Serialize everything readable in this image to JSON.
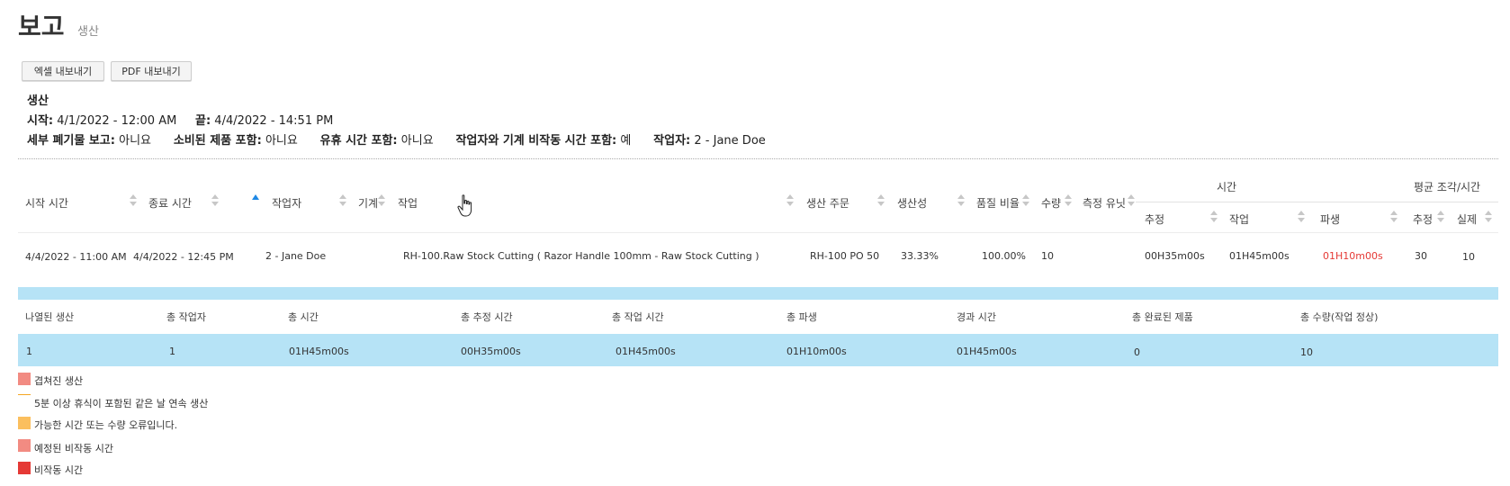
{
  "page": {
    "title": "보고",
    "subtitle": "생산"
  },
  "buttons": {
    "excel": "엑셀 내보내기",
    "pdf": "PDF 내보내기"
  },
  "info": {
    "heading": "생산",
    "start_label": "시작:",
    "start_value": "4/1/2022 - 12:00 AM",
    "end_label": "끝:",
    "end_value": "4/4/2022 - 14:51 PM",
    "detail_scrap_label": "세부 폐기물 보고:",
    "detail_scrap_value": "아니요",
    "consumed_label": "소비된 제품 포함:",
    "consumed_value": "아니요",
    "idle_label": "유휴 시간 포함:",
    "idle_value": "아니요",
    "downtime_label": "작업자와 기계 비작동 시간 포함:",
    "downtime_value": "예",
    "operator_label": "작업자:",
    "operator_value": "2 - Jane Doe"
  },
  "table": {
    "group_time": "시간",
    "group_avg": "평균 조각/시간",
    "headers": {
      "start_time": "시작 시간",
      "end_time": "종료 시간",
      "operator": "작업자",
      "machine": "기계",
      "job": "작업",
      "order": "생산 주문",
      "productivity": "생산성",
      "quality": "품질 비율",
      "quantity": "수량",
      "unit": "측정 유닛",
      "est": "추정",
      "work": "작업",
      "derived": "파생",
      "avg_est": "추정",
      "avg_actual": "실제"
    },
    "rows": [
      {
        "start_time": "4/4/2022 - 11:00 AM",
        "end_time": "4/4/2022 - 12:45 PM",
        "operator": "2 - Jane Doe",
        "machine": "",
        "job": "RH-100.Raw Stock Cutting ( Razor Handle 100mm - Raw Stock Cutting )",
        "order": "RH-100 PO 50",
        "productivity": "33.33%",
        "quality": "100.00%",
        "quantity": "10",
        "unit": "",
        "est": "00H35m00s",
        "work": "01H45m00s",
        "derived": "01H10m00s",
        "avg_est": "30",
        "avg_actual": "10"
      }
    ]
  },
  "summary": {
    "headers": [
      "나열된 생산",
      "총 작업자",
      "총 시간",
      "총 추정 시간",
      "총 작업 시간",
      "총 파생",
      "경과 시간",
      "총 완료된 제품",
      "총 수량(작업 정상)"
    ],
    "values": [
      "1",
      "1",
      "01H45m00s",
      "00H35m00s",
      "01H45m00s",
      "01H10m00s",
      "01H45m00s",
      "0",
      "10"
    ]
  },
  "legend": [
    {
      "label": "겹쳐진 생산",
      "color": "#f28b82",
      "kind": "box"
    },
    {
      "label": "5분 이상 휴식이 포함된 같은 날 연속 생산",
      "color": "#f5a623",
      "kind": "line"
    },
    {
      "label": "가능한 시간 또는 수량 오류입니다.",
      "color": "#fbbf5e",
      "kind": "box"
    },
    {
      "label": "예정된 비작동 시간",
      "color": "#f28b82",
      "kind": "box"
    },
    {
      "label": "비작동 시간",
      "color": "#e53935",
      "kind": "box"
    }
  ],
  "colors": {
    "accent_blue": "#b6e3f6",
    "derived_red": "#e53935",
    "sort_active": "#1e88e5"
  }
}
